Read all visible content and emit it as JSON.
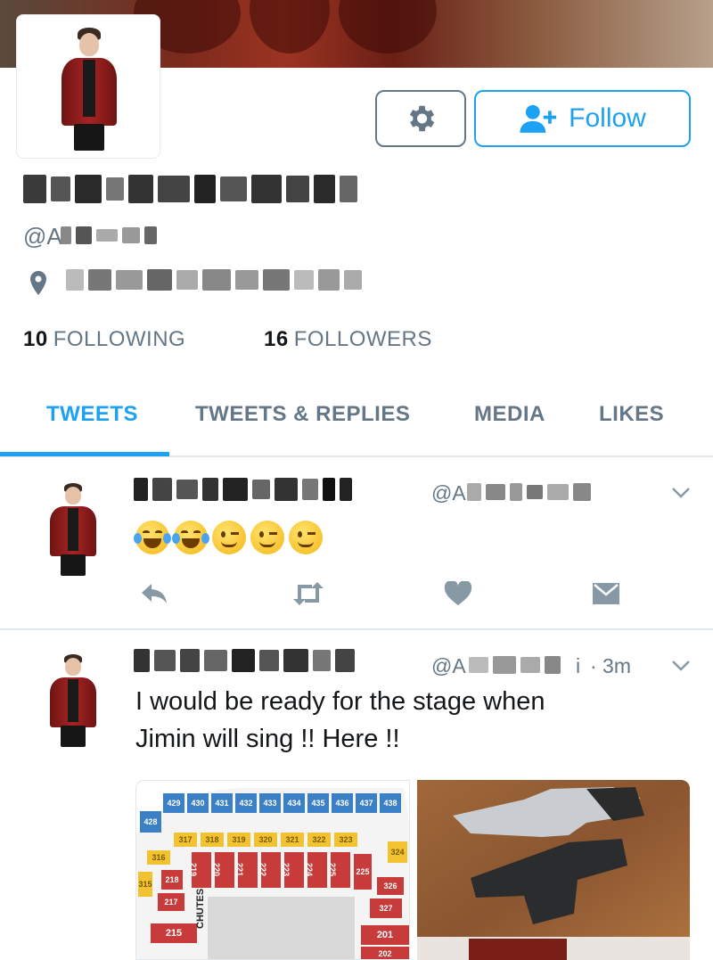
{
  "profile": {
    "follow_label": "Follow",
    "handle_prefix": "@A",
    "following_count": "10",
    "following_label": "FOLLOWING",
    "followers_count": "16",
    "followers_label": "FOLLOWERS",
    "icons": {
      "settings": "gear-icon",
      "follow": "add-user-icon",
      "location": "location-pin-icon"
    }
  },
  "tabs": [
    {
      "label": "TWEETS",
      "active": true
    },
    {
      "label": "TWEETS & REPLIES",
      "active": false
    },
    {
      "label": "MEDIA",
      "active": false
    },
    {
      "label": "LIKES",
      "active": false
    }
  ],
  "tweets": [
    {
      "handle_prefix": "@A",
      "time": "",
      "emojis": [
        "tears-of-joy",
        "tears-of-joy",
        "winking-face",
        "winking-face",
        "winking-face"
      ],
      "text": ""
    },
    {
      "handle_prefix": "@A",
      "handle_suffix": "i",
      "time": "· 3m",
      "text_line1": "I would be ready for the stage when",
      "text_line2": "Jimin will sing !! Here !!",
      "media_labels": {
        "row4": [
          "429",
          "430",
          "431",
          "432",
          "433",
          "434",
          "435",
          "436",
          "437",
          "438"
        ],
        "row3": [
          "317",
          "318",
          "319",
          "320",
          "321",
          "322",
          "323"
        ],
        "row2": [
          "219",
          "220",
          "221",
          "222",
          "223",
          "224",
          "225"
        ],
        "side": [
          "428",
          "316",
          "315",
          "218",
          "217",
          "215",
          "326",
          "324",
          "327",
          "225",
          "201",
          "202"
        ],
        "chutes": "CHUTES"
      }
    }
  ],
  "actions": [
    "reply-icon",
    "retweet-icon",
    "like-icon",
    "message-icon"
  ]
}
